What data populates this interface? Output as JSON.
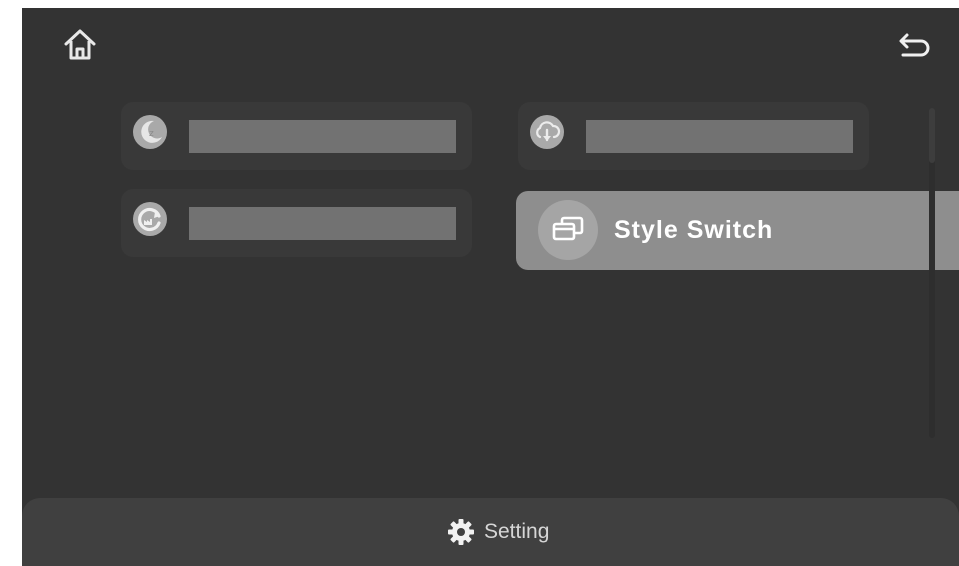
{
  "header": {
    "home_icon": "home-icon",
    "back_icon": "back-arrow-icon"
  },
  "tiles": [
    {
      "icon": "sleep-moon-icon",
      "label_redacted": true
    },
    {
      "icon": "cloud-download-icon",
      "label_redacted": true
    },
    {
      "icon": "factory-reset-icon",
      "label_redacted": true
    },
    {
      "icon": "style-switch-icon",
      "label": "Style Switch",
      "selected": true
    }
  ],
  "footer": {
    "icon": "gear-icon",
    "label": "Setting"
  },
  "colors": {
    "background": "#333333",
    "tile": "#393939",
    "selected_tile": "#8e8e8e",
    "text": "#ffffff"
  }
}
